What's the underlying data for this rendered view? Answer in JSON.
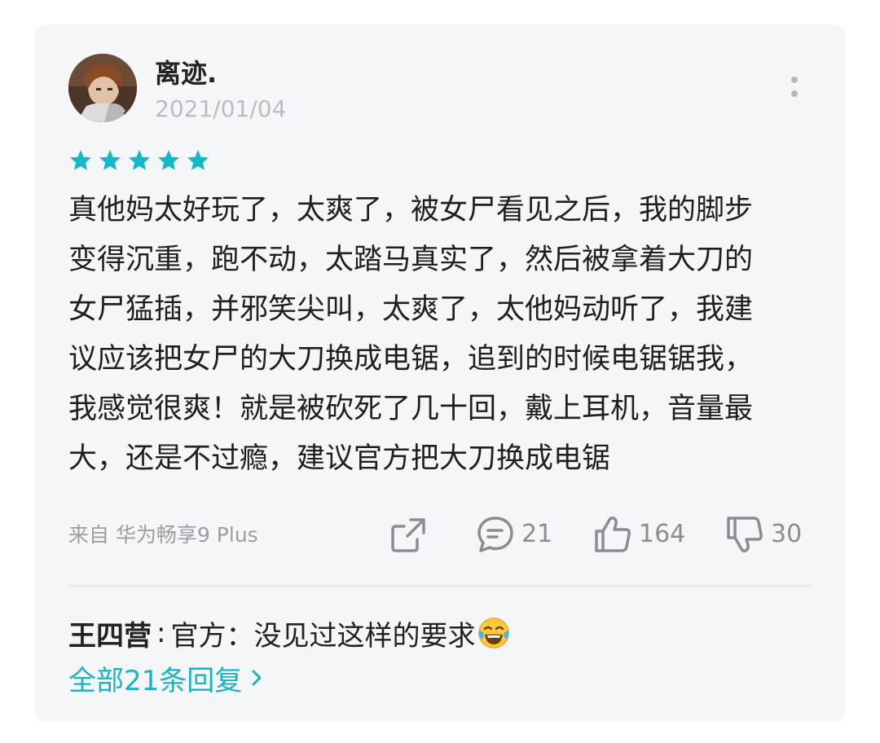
{
  "review": {
    "username": "离迹.",
    "date": "2021/01/04",
    "rating": 5,
    "text_lines": [
      "真他妈太好玩了，太爽了，被女尸看见之后，我的脚步",
      "变得沉重，跑不动，太踏马真实了，然后被拿着大刀的",
      "女尸猛插，并邪笑尖叫，太爽了，太他妈动听了，我建",
      "议应该把女尸的大刀换成电锯，追到的时候电锯锯我，",
      "我感觉很爽！就是被砍死了几十回，戴上耳机，音量最",
      "大，还是不过瘾，建议官方把大刀换成电锯"
    ],
    "device": "来自 华为畅享9 Plus"
  },
  "actions": {
    "comments_count": "21",
    "likes_count": "164",
    "dislikes_count": "30"
  },
  "reply": {
    "author": "王四营",
    "separator": ":",
    "text": "官方：没见过这样的要求"
  },
  "all_replies_label": "全部21条回复",
  "colors": {
    "accent": "#19b3c4",
    "star": "#14b8c6",
    "card_bg": "#f5f6f8",
    "icon_gray": "#8a8d93"
  },
  "icons": {
    "more": "more-vertical-icon",
    "share": "share-icon",
    "comment": "comment-icon",
    "like": "thumbs-up-icon",
    "dislike": "thumbs-down-icon",
    "emoji": "tears-of-joy-emoji"
  }
}
